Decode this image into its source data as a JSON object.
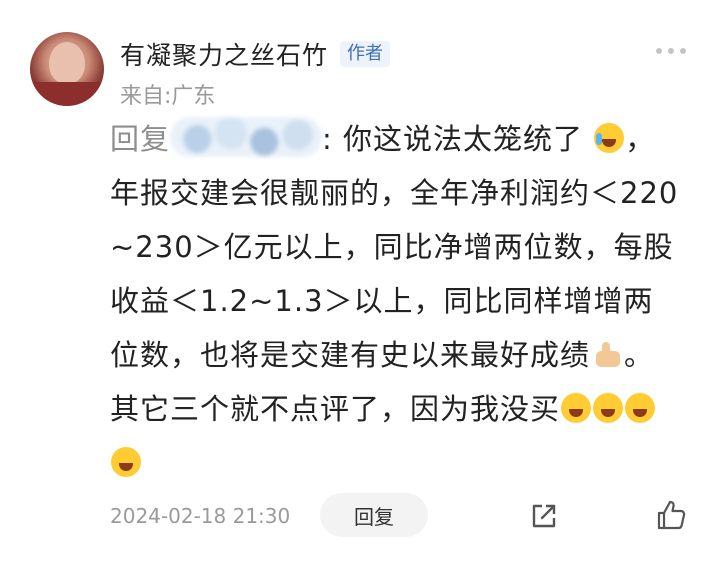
{
  "author": {
    "name": "有凝聚力之丝石竹",
    "badge": "作者"
  },
  "source": "来自:广东",
  "comment": {
    "reply_prefix": "回复",
    "reply_sep": ":",
    "text_line1": " 你这说法太笼统了",
    "text_line2": "，年报交建会很靓丽的，全年净利润约＜220~230＞亿元以上，同比净增两位数，每股收益＜1.2~1.3＞以上，同比同样增增两位数，也将是交建有史以来最好成绩",
    "text_line3": "。其它三个就不点评了，因为我没买"
  },
  "footer": {
    "timestamp": "2024-02-18 21:30",
    "reply_label": "回复"
  },
  "icons": {
    "more": "more-dots-icon",
    "share": "share-icon",
    "like": "thumbs-up-icon"
  },
  "colors": {
    "badge_text": "#3f6fb5",
    "muted": "#9a9a9a"
  }
}
